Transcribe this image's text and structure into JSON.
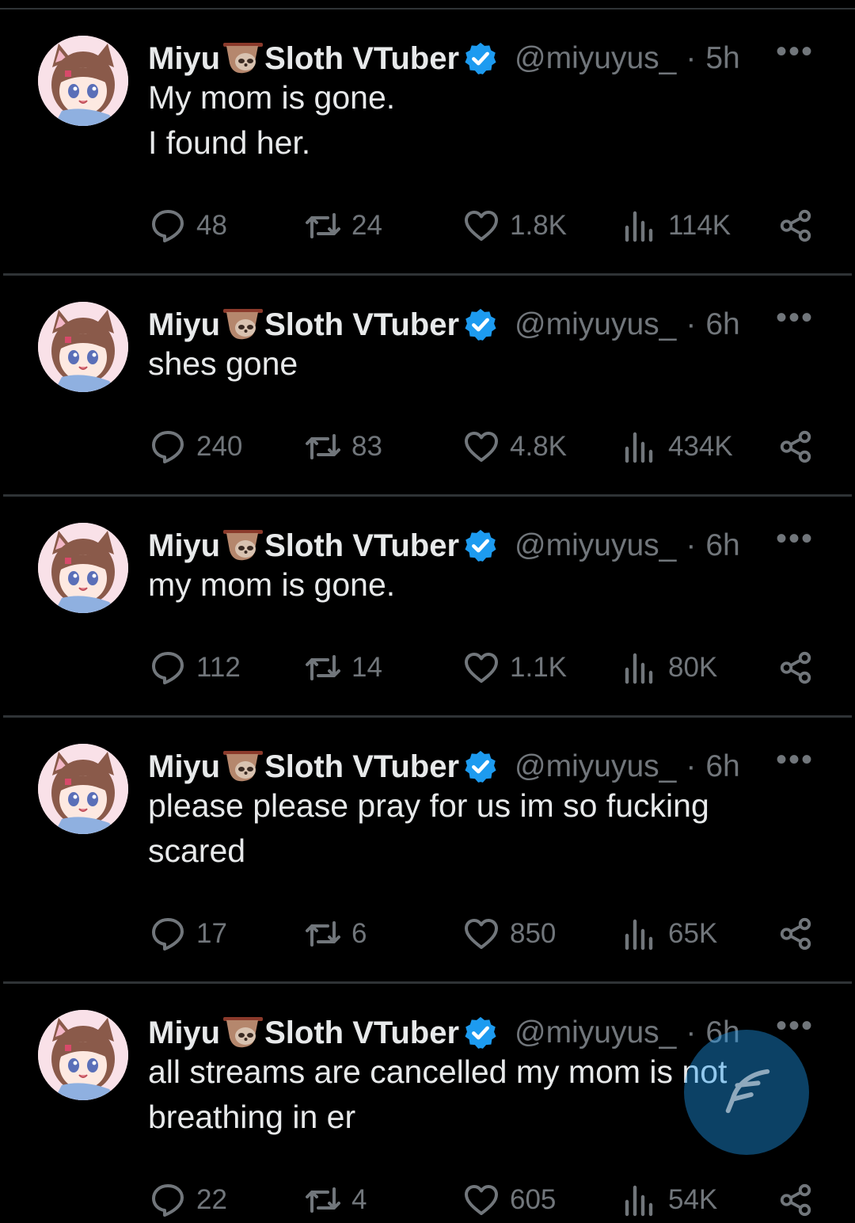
{
  "tweets": [
    {
      "name_part1": "Miyu",
      "name_part2": "Sloth VTuber",
      "handle": "@miyuyus_",
      "time": "5h",
      "text_lines": [
        "My mom is gone.",
        "I found her."
      ],
      "replies": "48",
      "retweets": "24",
      "likes": "1.8K",
      "views": "114K"
    },
    {
      "name_part1": "Miyu",
      "name_part2": "Sloth VTuber",
      "handle": "@miyuyus_",
      "time": "6h",
      "text_lines": [
        "shes gone"
      ],
      "replies": "240",
      "retweets": "83",
      "likes": "4.8K",
      "views": "434K"
    },
    {
      "name_part1": "Miyu",
      "name_part2": "Sloth VTuber",
      "handle": "@miyuyus_",
      "time": "6h",
      "text_lines": [
        "my mom is gone."
      ],
      "replies": "112",
      "retweets": "14",
      "likes": "1.1K",
      "views": "80K"
    },
    {
      "name_part1": "Miyu",
      "name_part2": "Sloth VTuber",
      "handle": "@miyuyus_",
      "time": "6h",
      "text_lines": [
        "please please pray for us im so fucking",
        "scared"
      ],
      "replies": "17",
      "retweets": "6",
      "likes": "850",
      "views": "65K"
    },
    {
      "name_part1": "Miyu",
      "name_part2": "Sloth VTuber",
      "handle": "@miyuyus_",
      "time": "6h",
      "text_lines": [
        "all streams are cancelled my mom is not",
        "breathing in er"
      ],
      "replies": "22",
      "retweets": "4",
      "likes": "605",
      "views": "54K"
    }
  ],
  "icons": {
    "reply": "reply-icon",
    "retweet": "retweet-icon",
    "like": "heart-icon",
    "views": "views-icon",
    "share": "share-icon",
    "verified": "verified-badge-icon",
    "more": "more-icon",
    "compose": "compose-icon",
    "sloth": "sloth-emoji-icon"
  },
  "colors": {
    "background": "#000000",
    "text": "#e7e9ea",
    "muted": "#71767b",
    "accent": "#1d9bf0",
    "divider": "#2f3336"
  }
}
